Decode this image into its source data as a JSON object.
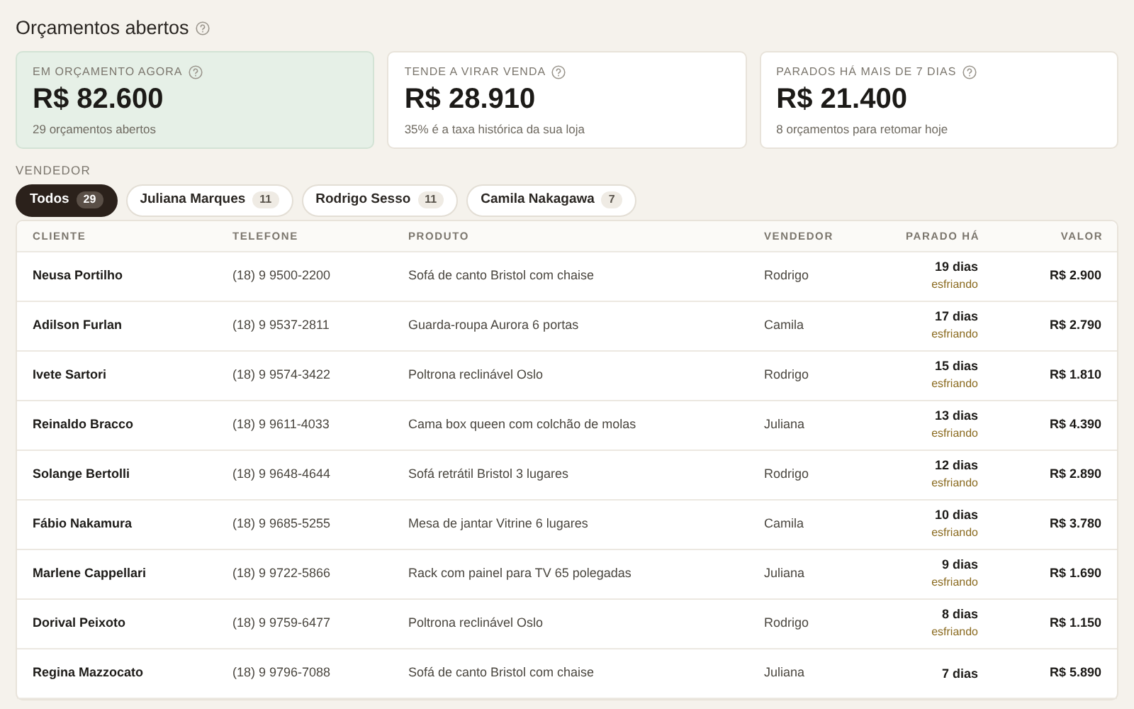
{
  "page": {
    "title": "Orçamentos abertos"
  },
  "summary_cards": [
    {
      "label": "EM ORÇAMENTO AGORA",
      "value": "R$ 82.600",
      "note": "29 orçamentos abertos",
      "highlighted": true
    },
    {
      "label": "TENDE A VIRAR VENDA",
      "value": "R$ 28.910",
      "note": "35% é a taxa histórica da sua loja",
      "highlighted": false
    },
    {
      "label": "PARADOS HÁ MAIS DE 7 DIAS",
      "value": "R$ 21.400",
      "note": "8 orçamentos para retomar hoje",
      "highlighted": false
    }
  ],
  "filter": {
    "label": "VENDEDOR",
    "tabs": [
      {
        "label": "Todos",
        "count": "29",
        "selected": true
      },
      {
        "label": "Juliana Marques",
        "count": "11",
        "selected": false
      },
      {
        "label": "Rodrigo Sesso",
        "count": "11",
        "selected": false
      },
      {
        "label": "Camila Nakagawa",
        "count": "7",
        "selected": false
      }
    ]
  },
  "table": {
    "columns": [
      "CLIENTE",
      "TELEFONE",
      "PRODUTO",
      "VENDEDOR",
      "PARADO HÁ",
      "VALOR"
    ],
    "rows": [
      {
        "client": "Neusa Portilho",
        "phone": "(18) 9 9500-2200",
        "product": "Sofá de canto Bristol com chaise",
        "seller": "Rodrigo",
        "idle": "19 dias",
        "status": "esfriando",
        "value": "R$ 2.900"
      },
      {
        "client": "Adilson Furlan",
        "phone": "(18) 9 9537-2811",
        "product": "Guarda-roupa Aurora 6 portas",
        "seller": "Camila",
        "idle": "17 dias",
        "status": "esfriando",
        "value": "R$ 2.790"
      },
      {
        "client": "Ivete Sartori",
        "phone": "(18) 9 9574-3422",
        "product": "Poltrona reclinável Oslo",
        "seller": "Rodrigo",
        "idle": "15 dias",
        "status": "esfriando",
        "value": "R$ 1.810"
      },
      {
        "client": "Reinaldo Bracco",
        "phone": "(18) 9 9611-4033",
        "product": "Cama box queen com colchão de molas",
        "seller": "Juliana",
        "idle": "13 dias",
        "status": "esfriando",
        "value": "R$ 4.390"
      },
      {
        "client": "Solange Bertolli",
        "phone": "(18) 9 9648-4644",
        "product": "Sofá retrátil Bristol 3 lugares",
        "seller": "Rodrigo",
        "idle": "12 dias",
        "status": "esfriando",
        "value": "R$ 2.890"
      },
      {
        "client": "Fábio Nakamura",
        "phone": "(18) 9 9685-5255",
        "product": "Mesa de jantar Vitrine 6 lugares",
        "seller": "Camila",
        "idle": "10 dias",
        "status": "esfriando",
        "value": "R$ 3.780"
      },
      {
        "client": "Marlene Cappellari",
        "phone": "(18) 9 9722-5866",
        "product": "Rack com painel para TV 65 polegadas",
        "seller": "Juliana",
        "idle": "9 dias",
        "status": "esfriando",
        "value": "R$ 1.690"
      },
      {
        "client": "Dorival Peixoto",
        "phone": "(18) 9 9759-6477",
        "product": "Poltrona reclinável Oslo",
        "seller": "Rodrigo",
        "idle": "8 dias",
        "status": "esfriando",
        "value": "R$ 1.150"
      },
      {
        "client": "Regina Mazzocato",
        "phone": "(18) 9 9796-7088",
        "product": "Sofá de canto Bristol com chaise",
        "seller": "Juliana",
        "idle": "7 dias",
        "value": "R$ 5.890"
      }
    ]
  }
}
